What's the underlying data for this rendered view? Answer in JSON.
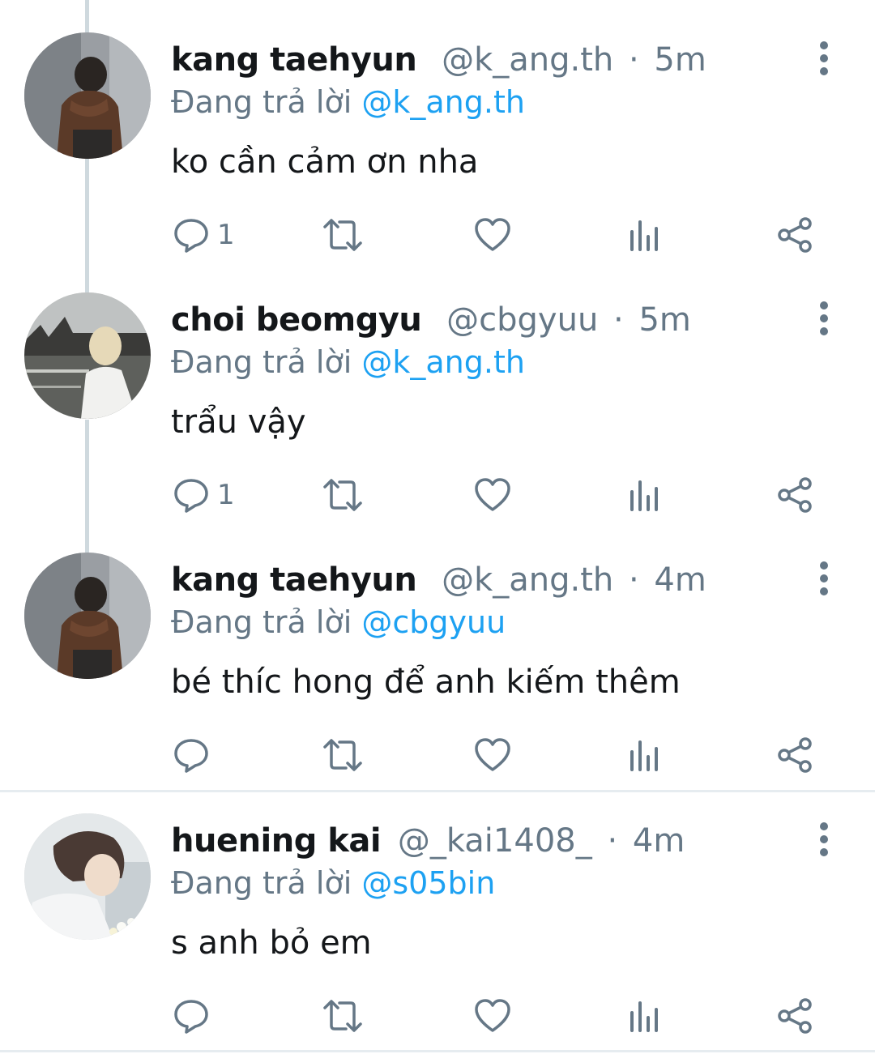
{
  "tweets": [
    {
      "name": "kang taehyun",
      "handle": "@k_ang.th",
      "separator": "·",
      "time": "5m",
      "reply_prefix": "Đang trả lời",
      "reply_to": "@k_ang.th",
      "text": "ko cần cảm ơn nha",
      "reply_count": "1"
    },
    {
      "name": "choi beomgyu",
      "handle": "@cbgyuu",
      "separator": "·",
      "time": "5m",
      "reply_prefix": "Đang trả lời",
      "reply_to": "@k_ang.th",
      "text": "trẩu vậy",
      "reply_count": "1"
    },
    {
      "name": "kang taehyun",
      "handle": "@k_ang.th",
      "separator": "·",
      "time": "4m",
      "reply_prefix": "Đang trả lời",
      "reply_to": "@cbgyuu",
      "text": "bé thíc hong để anh kiếm thêm",
      "reply_count": ""
    },
    {
      "name": "huening kai",
      "handle": "@_kai1408_",
      "separator": "·",
      "time": "4m",
      "reply_prefix": "Đang trả lời",
      "reply_to": "@s05bin",
      "text": "s anh bỏ em",
      "reply_count": ""
    }
  ],
  "icons": [
    "reply-icon",
    "retweet-icon",
    "like-icon",
    "analytics-icon",
    "share-icon",
    "more-options-icon"
  ],
  "colors": {
    "text": "#14171a",
    "secondary": "#657786",
    "mention": "#1da1f2",
    "thread_line": "#cfd9de",
    "divider": "#e6ecf0"
  }
}
